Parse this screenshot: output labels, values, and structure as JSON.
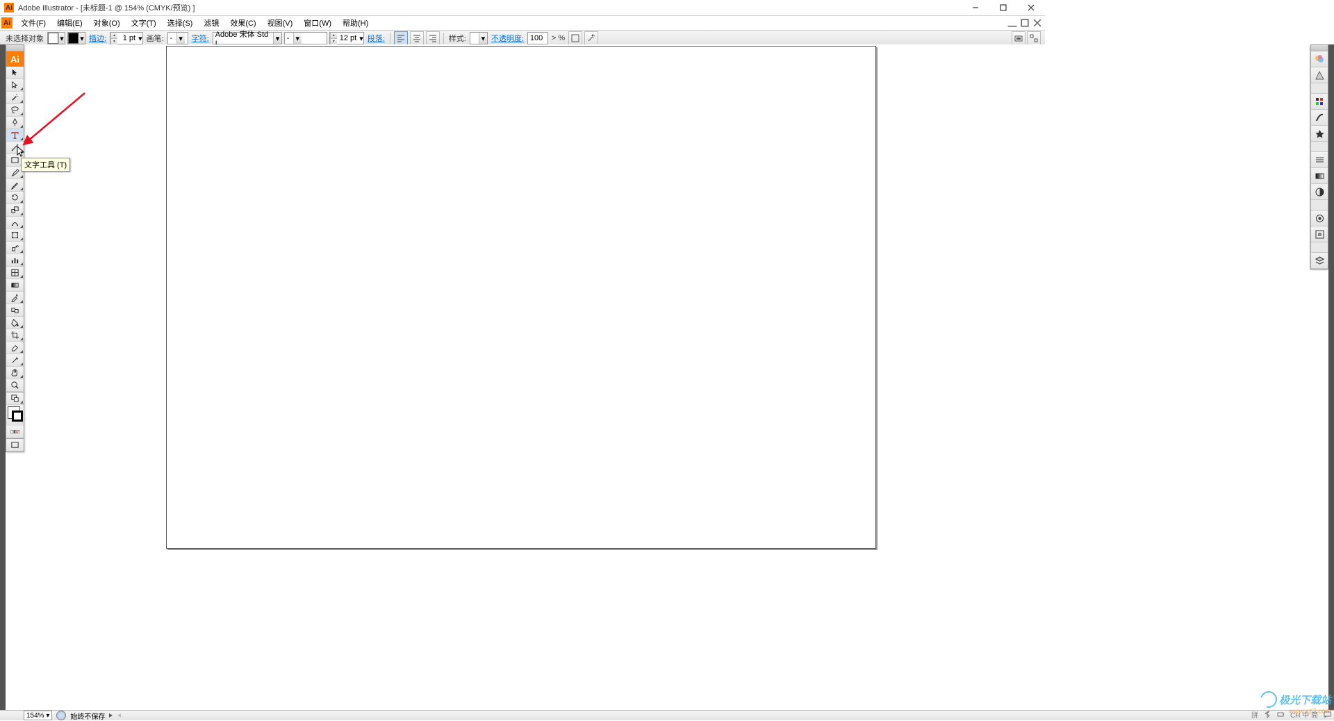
{
  "title": "Adobe Illustrator - [未标题-1 @ 154% (CMYK/预览) ]",
  "menu": [
    "文件(F)",
    "编辑(E)",
    "对象(O)",
    "文字(T)",
    "选择(S)",
    "滤镜",
    "效果(C)",
    "视图(V)",
    "窗口(W)",
    "帮助(H)"
  ],
  "ctrl": {
    "selection": "未选择对象",
    "stroke_label": "描边:",
    "stroke_weight": "1 pt",
    "brush_label": "画笔:",
    "char_label": "字符:",
    "font": "Adobe 宋体 Std L",
    "font_style": "-",
    "font_size": "12 pt",
    "para_label": "段落:",
    "style_label": "样式:",
    "opacity_label": "不透明度:",
    "opacity_value": "100",
    "opacity_unit": "> %"
  },
  "tooltip": "文字工具 (T)",
  "status": {
    "zoom": "154%",
    "save": "始终不保存"
  },
  "watermark": {
    "brand": "极光下载站",
    "url": "www.xz7.com"
  }
}
